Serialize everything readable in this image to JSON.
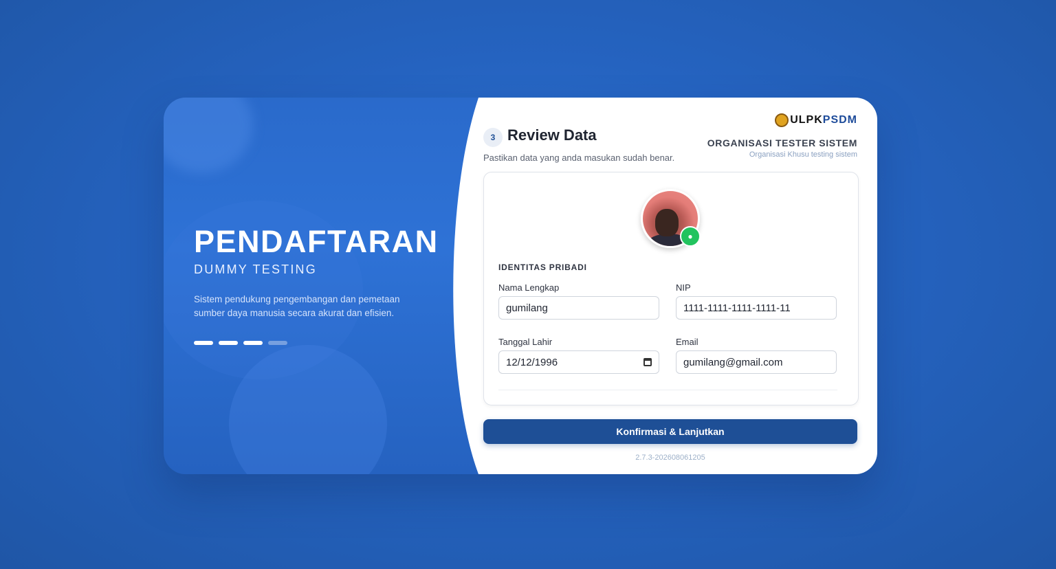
{
  "hero": {
    "title": "PENDAFTARAN",
    "subtitle": "DUMMY TESTING",
    "description": "Sistem pendukung pengembangan dan pemetaan sumber daya manusia secara akurat dan efisien.",
    "carousel": {
      "total": 4,
      "active": 3
    }
  },
  "step": {
    "number": "3",
    "title": "Review Data",
    "description": "Pastikan data yang anda masukan sudah benar."
  },
  "org": {
    "logo_text_a": "ULPK",
    "logo_text_b": "PSDM",
    "name": "ORGANISASI TESTER SISTEM",
    "tagline": "Organisasi Khusu testing sistem"
  },
  "form": {
    "section_title": "IDENTITAS PRIBADI",
    "fields": {
      "nama": {
        "label": "Nama Lengkap",
        "value": "gumilang"
      },
      "nip": {
        "label": "NIP",
        "value": "1111-1111-1111-1111-11"
      },
      "tanggal": {
        "label": "Tanggal Lahir",
        "value": "12/12/1996"
      },
      "email": {
        "label": "Email",
        "value": "gumilang@gmail.com"
      }
    }
  },
  "actions": {
    "confirm_label": "Konfirmasi & Lanjutkan"
  },
  "version": "2.7.3-202608061205",
  "colors": {
    "primary": "#1e4f96",
    "accent_green": "#22c35e",
    "bg_blue": "#2563c0"
  }
}
